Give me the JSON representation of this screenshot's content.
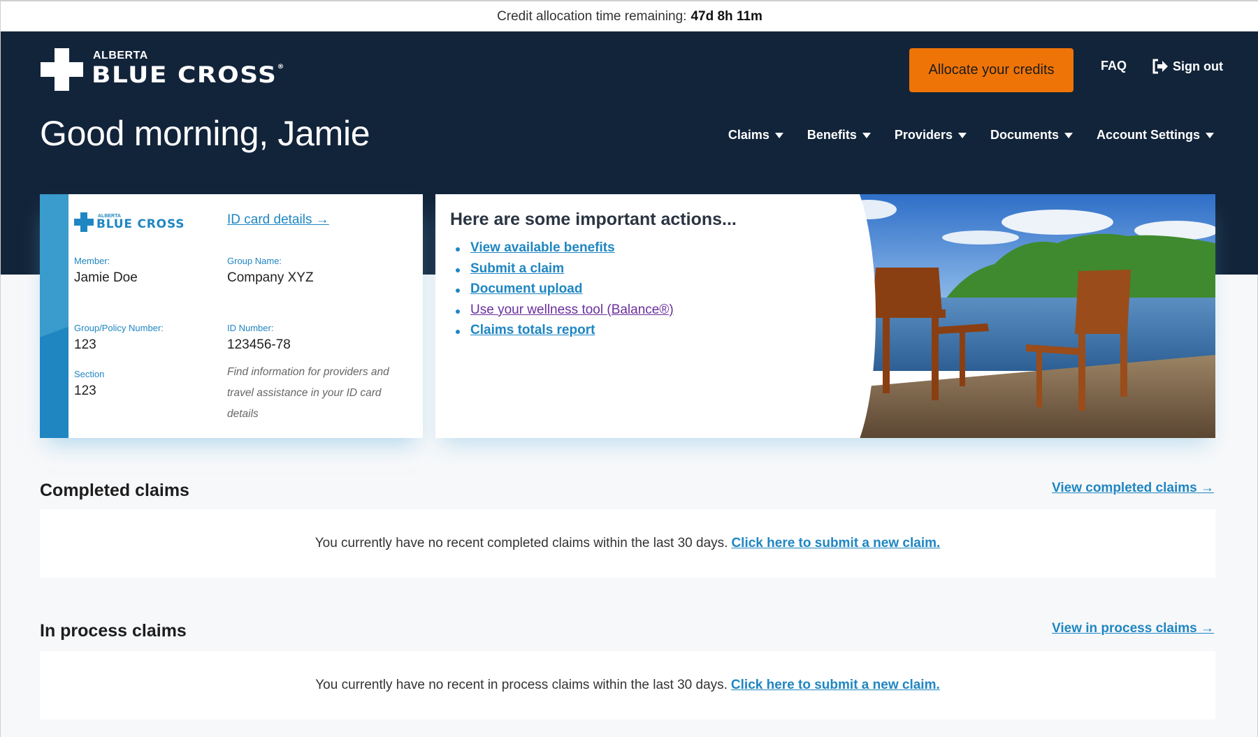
{
  "topbar": {
    "label": "Credit allocation time remaining:",
    "time_remaining": "47d 8h 11m"
  },
  "header": {
    "logo": {
      "small": "ALBERTA",
      "big": "BLUE CROSS",
      "mark": "®"
    },
    "allocate_button": "Allocate your credits",
    "faq_link": "FAQ",
    "signout_link": "Sign out",
    "greeting": "Good morning, Jamie",
    "nav": [
      {
        "label": "Claims"
      },
      {
        "label": "Benefits"
      },
      {
        "label": "Providers"
      },
      {
        "label": "Documents"
      },
      {
        "label": "Account Settings"
      }
    ],
    "colors": {
      "background": "#12243a",
      "accent": "#ef7407"
    }
  },
  "id_card": {
    "logo_small": "ALBERTA",
    "logo_big": "BLUE CROSS",
    "details_link": "ID card details",
    "member_label": "Member:",
    "member_value": "Jamie Doe",
    "group_name_label": "Group Name:",
    "group_name_value": "Company XYZ",
    "policy_label": "Group/Policy Number:",
    "policy_value": "123",
    "id_label": "ID Number:",
    "id_value": "123456-78",
    "section_label": "Section",
    "section_value": "123",
    "note": "Find information for providers and travel assistance in your ID card details"
  },
  "actions": {
    "title": "Here are some important actions...",
    "links": [
      {
        "label": "View available benefits"
      },
      {
        "label": "Submit a claim"
      },
      {
        "label": "Document upload"
      },
      {
        "label": "Use your wellness tool (Balance®)"
      },
      {
        "label": "Claims totals report"
      }
    ],
    "image_description": "Two wooden Adirondack chairs on a dock overlooking a lake"
  },
  "completed_claims": {
    "title": "Completed claims",
    "view_link": "View completed claims",
    "message": "You currently have no recent completed claims within the last 30 days.",
    "submit_link": "Click here to submit a new claim."
  },
  "in_process_claims": {
    "title": "In process claims",
    "view_link": "View in process claims",
    "message": "You currently have no recent in process claims within the last 30 days.",
    "submit_link": "Click here to submit a new claim."
  }
}
